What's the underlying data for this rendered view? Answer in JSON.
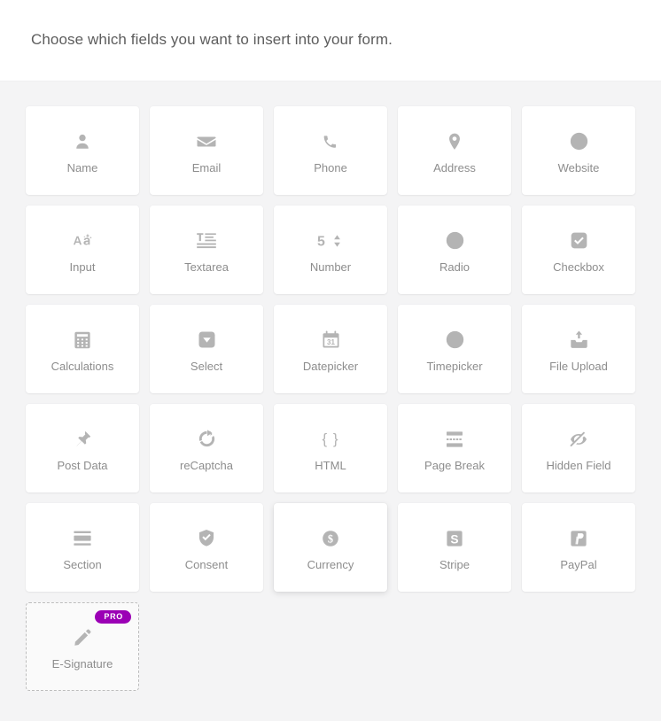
{
  "header": {
    "title": "Choose which fields you want to insert into your form."
  },
  "fields": [
    {
      "label": "Name",
      "icon": "user-icon",
      "pro": false,
      "hovered": false
    },
    {
      "label": "Email",
      "icon": "envelope-icon",
      "pro": false,
      "hovered": false
    },
    {
      "label": "Phone",
      "icon": "phone-icon",
      "pro": false,
      "hovered": false
    },
    {
      "label": "Address",
      "icon": "map-pin-icon",
      "pro": false,
      "hovered": false
    },
    {
      "label": "Website",
      "icon": "globe-icon",
      "pro": false,
      "hovered": false
    },
    {
      "label": "Input",
      "icon": "text-input-icon",
      "pro": false,
      "hovered": false
    },
    {
      "label": "Textarea",
      "icon": "textarea-icon",
      "pro": false,
      "hovered": false
    },
    {
      "label": "Number",
      "icon": "number-stepper-icon",
      "pro": false,
      "hovered": false
    },
    {
      "label": "Radio",
      "icon": "radio-button-icon",
      "pro": false,
      "hovered": false
    },
    {
      "label": "Checkbox",
      "icon": "checkbox-icon",
      "pro": false,
      "hovered": false
    },
    {
      "label": "Calculations",
      "icon": "calculator-icon",
      "pro": false,
      "hovered": false
    },
    {
      "label": "Select",
      "icon": "dropdown-caret-icon",
      "pro": false,
      "hovered": false
    },
    {
      "label": "Datepicker",
      "icon": "calendar-icon",
      "pro": false,
      "hovered": false
    },
    {
      "label": "Timepicker",
      "icon": "clock-icon",
      "pro": false,
      "hovered": false
    },
    {
      "label": "File Upload",
      "icon": "file-upload-icon",
      "pro": false,
      "hovered": false
    },
    {
      "label": "Post Data",
      "icon": "pushpin-icon",
      "pro": false,
      "hovered": false
    },
    {
      "label": "reCaptcha",
      "icon": "recaptcha-icon",
      "pro": false,
      "hovered": false
    },
    {
      "label": "HTML",
      "icon": "curly-braces-icon",
      "pro": false,
      "hovered": false
    },
    {
      "label": "Page Break",
      "icon": "page-break-icon",
      "pro": false,
      "hovered": false
    },
    {
      "label": "Hidden Field",
      "icon": "eye-slash-icon",
      "pro": false,
      "hovered": false
    },
    {
      "label": "Section",
      "icon": "section-icon",
      "pro": false,
      "hovered": false
    },
    {
      "label": "Consent",
      "icon": "shield-check-icon",
      "pro": false,
      "hovered": false
    },
    {
      "label": "Currency",
      "icon": "dollar-coin-icon",
      "pro": false,
      "hovered": true
    },
    {
      "label": "Stripe",
      "icon": "stripe-icon",
      "pro": false,
      "hovered": false
    },
    {
      "label": "PayPal",
      "icon": "paypal-icon",
      "pro": false,
      "hovered": false
    },
    {
      "label": "E-Signature",
      "icon": "pencil-icon",
      "pro": true,
      "hovered": false
    }
  ],
  "badges": {
    "pro_label": "PRO"
  },
  "colors": {
    "page_background": "#f4f4f5",
    "header_background": "#ffffff",
    "card_background": "#ffffff",
    "icon": "#b4b4b4",
    "label": "#8d8d8d",
    "heading": "#5d5d5d",
    "pro_badge": "#9b00b5"
  },
  "number_icon_text": "5"
}
